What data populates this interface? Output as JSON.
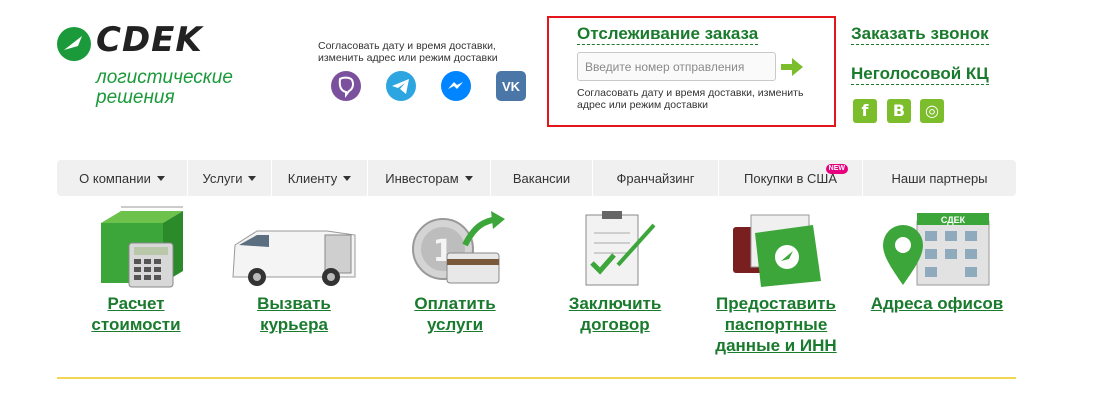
{
  "logo": {
    "wordmark": "CDEK",
    "tagline_1": "логистические",
    "tagline_2": "решения"
  },
  "messengers": {
    "description": "Согласовать дату и время доставки, изменить адрес или режим доставки",
    "icons": [
      "viber-icon",
      "telegram-icon",
      "messenger-icon",
      "vk-icon"
    ]
  },
  "tracking": {
    "title": "Отслеживание заказа",
    "placeholder": "Введите номер отправления",
    "note": "Согласовать дату и время доставки, изменить адрес или режим доставки"
  },
  "header_links": {
    "callback": "Заказать звонок",
    "non_voice": "Неголосовой КЦ"
  },
  "social": [
    {
      "icon": "facebook-icon",
      "glyph": "f"
    },
    {
      "icon": "vkontakte-icon",
      "glyph": "B"
    },
    {
      "icon": "instagram-icon",
      "glyph": "◎"
    }
  ],
  "nav": {
    "items": [
      {
        "label": "О компании",
        "dropdown": true
      },
      {
        "label": "Услуги",
        "dropdown": true
      },
      {
        "label": "Клиенту",
        "dropdown": true
      },
      {
        "label": "Инвесторам",
        "dropdown": true
      },
      {
        "label": "Вакансии",
        "dropdown": false
      },
      {
        "label": "Франчайзинг",
        "dropdown": false
      },
      {
        "label": "Покупки в США",
        "dropdown": false,
        "badge": "NEW"
      },
      {
        "label": "Наши партнеры",
        "dropdown": false
      }
    ]
  },
  "tiles": [
    {
      "line1": "Расчет",
      "line2": "стоимости",
      "line3": ""
    },
    {
      "line1": "Вызвать",
      "line2": "курьера",
      "line3": ""
    },
    {
      "line1": "Оплатить",
      "line2": "услуги",
      "line3": ""
    },
    {
      "line1": "Заключить",
      "line2": "договор",
      "line3": ""
    },
    {
      "line1": "Предоставить",
      "line2": "паспортные",
      "line3": "данные и ИНН"
    },
    {
      "line1": "Адреса офисов",
      "line2": "",
      "line3": ""
    }
  ],
  "colors": {
    "brand_green": "#1a7a2d",
    "light_green": "#7cbd2c",
    "highlight_red": "#e4161b",
    "nav_bg": "#f0f0f0",
    "divider_yellow": "#f3d651"
  }
}
